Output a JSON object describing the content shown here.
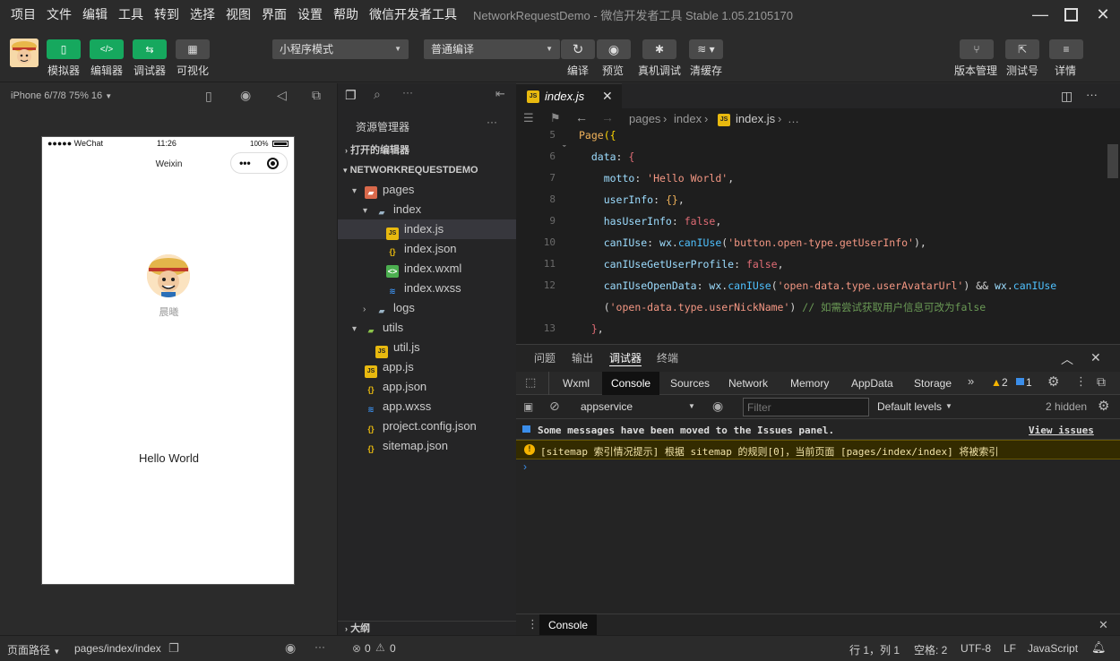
{
  "menu": {
    "items": [
      "项目",
      "文件",
      "编辑",
      "工具",
      "转到",
      "选择",
      "视图",
      "界面",
      "设置",
      "帮助",
      "微信开发者工具"
    ],
    "title": "NetworkRequestDemo - 微信开发者工具 Stable 1.05.2105170"
  },
  "toolbar": {
    "simulator": "模拟器",
    "editor": "编辑器",
    "debugger": "调试器",
    "visual": "可视化",
    "mode_select": "小程序模式",
    "compile_select": "普通编译",
    "compile": "编译",
    "preview": "预览",
    "real_debug": "真机调试",
    "clear_cache": "清缓存",
    "version": "版本管理",
    "test_id": "测试号",
    "details": "详情"
  },
  "simulator": {
    "device": "iPhone 6/7/8 75% 16",
    "status_left": "●●●●● WeChat",
    "status_time": "11:26",
    "status_battery": "100%",
    "nav_title": "Weixin",
    "nickname": "晨曦",
    "motto": "Hello World"
  },
  "explorer": {
    "title": "资源管理器",
    "open_editors": "打开的编辑器",
    "project": "NETWORKREQUESTDEMO",
    "outline": "大纲",
    "tree": [
      {
        "name": "pages",
        "icon": "folder-red-icon",
        "indent": 1,
        "chevron": "▾"
      },
      {
        "name": "index",
        "icon": "folder-icon",
        "indent": 2,
        "chevron": "▾"
      },
      {
        "name": "index.js",
        "icon": "js-icon",
        "indent": 3,
        "chevron": ""
      },
      {
        "name": "index.json",
        "icon": "json-icon",
        "indent": 3,
        "chevron": ""
      },
      {
        "name": "index.wxml",
        "icon": "wxml-icon",
        "indent": 3,
        "chevron": ""
      },
      {
        "name": "index.wxss",
        "icon": "wxss-icon",
        "indent": 3,
        "chevron": ""
      },
      {
        "name": "logs",
        "icon": "folder-icon",
        "indent": 2,
        "chevron": "›"
      },
      {
        "name": "utils",
        "icon": "folder-green-icon",
        "indent": 1,
        "chevron": "▾"
      },
      {
        "name": "util.js",
        "icon": "js-icon",
        "indent": 2,
        "chevron": ""
      },
      {
        "name": "app.js",
        "icon": "js-icon",
        "indent": 1,
        "chevron": ""
      },
      {
        "name": "app.json",
        "icon": "json-icon",
        "indent": 1,
        "chevron": ""
      },
      {
        "name": "app.wxss",
        "icon": "wxss-icon",
        "indent": 1,
        "chevron": ""
      },
      {
        "name": "project.config.json",
        "icon": "json-icon",
        "indent": 1,
        "chevron": ""
      },
      {
        "name": "sitemap.json",
        "icon": "json-icon",
        "indent": 1,
        "chevron": ""
      }
    ]
  },
  "editor": {
    "tab": "index.js",
    "crumb": {
      "a": "pages",
      "b": "index",
      "c": "index.js",
      "d": "…"
    },
    "lines": [
      {
        "n": "5",
        "parts": [
          [
            "k",
            "Page"
          ],
          [
            "brk",
            "({"
          ]
        ]
      },
      {
        "n": "6",
        "parts": [
          [
            "p",
            "  data"
          ],
          [
            "d",
            ": "
          ],
          [
            "b",
            "{"
          ]
        ]
      },
      {
        "n": "7",
        "parts": [
          [
            "p",
            "    motto"
          ],
          [
            "d",
            ": "
          ],
          [
            "s",
            "'Hello World'"
          ],
          [
            "d",
            ","
          ]
        ]
      },
      {
        "n": "8",
        "parts": [
          [
            "p",
            "    userInfo"
          ],
          [
            "d",
            ": "
          ],
          [
            "k",
            "{}"
          ],
          [
            "d",
            ","
          ]
        ]
      },
      {
        "n": "9",
        "parts": [
          [
            "p",
            "    hasUserInfo"
          ],
          [
            "d",
            ": "
          ],
          [
            "b",
            "false"
          ],
          [
            "d",
            ","
          ]
        ]
      },
      {
        "n": "10",
        "parts": [
          [
            "p",
            "    canIUse"
          ],
          [
            "d",
            ": "
          ],
          [
            "p",
            "wx"
          ],
          [
            "d",
            "."
          ],
          [
            "f",
            "canIUse"
          ],
          [
            "d",
            "("
          ],
          [
            "s",
            "'button.open-type.getUserInfo'"
          ],
          [
            "d",
            "),"
          ]
        ]
      },
      {
        "n": "11",
        "parts": [
          [
            "p",
            "    canIUseGetUserProfile"
          ],
          [
            "d",
            ": "
          ],
          [
            "b",
            "false"
          ],
          [
            "d",
            ","
          ]
        ]
      },
      {
        "n": "12",
        "parts": [
          [
            "p",
            "    canIUseOpenData"
          ],
          [
            "d",
            ": "
          ],
          [
            "p",
            "wx"
          ],
          [
            "d",
            "."
          ],
          [
            "f",
            "canIUse"
          ],
          [
            "d",
            "("
          ],
          [
            "s",
            "'open-data.type.userAvatarUrl'"
          ],
          [
            "d",
            ") && "
          ],
          [
            "p",
            "wx"
          ],
          [
            "d",
            "."
          ],
          [
            "f",
            "canIUse"
          ]
        ]
      },
      {
        "n": "",
        "parts": [
          [
            "d",
            "    ("
          ],
          [
            "s",
            "'open-data.type.userNickName'"
          ],
          [
            "d",
            ") "
          ],
          [
            "c",
            "// 如需尝试获取用户信息可改为false"
          ]
        ]
      },
      {
        "n": "13",
        "parts": [
          [
            "b",
            "  }"
          ],
          [
            "d",
            ","
          ]
        ]
      }
    ]
  },
  "devtools": {
    "panel_tabs": [
      "问题",
      "输出",
      "调试器",
      "终端"
    ],
    "tabs": [
      "Wxml",
      "Console",
      "Sources",
      "Network",
      "Memory",
      "AppData",
      "Storage"
    ],
    "warn_count": "2",
    "info_count": "1",
    "context": "appservice",
    "filter_placeholder": "Filter",
    "levels": "Default levels",
    "hidden": "2 hidden",
    "msg1": "Some messages have been moved to the Issues panel.",
    "view_issues": "View issues",
    "msg2": "[sitemap 索引情况提示] 根据 sitemap 的规则[0]，当前页面 [pages/index/index] 将被索引",
    "prompt": "›",
    "drawer_tab": "Console"
  },
  "status": {
    "path_label": "页面路径",
    "path": "pages/index/index",
    "errors": "0",
    "warnings": "0",
    "position": "行 1，列 1",
    "spaces": "空格: 2",
    "encoding": "UTF-8",
    "eol": "LF",
    "language": "JavaScript"
  },
  "colors": {
    "accent": "#16a85e",
    "selection": "#37373d",
    "warning_bg": "#332b00"
  }
}
